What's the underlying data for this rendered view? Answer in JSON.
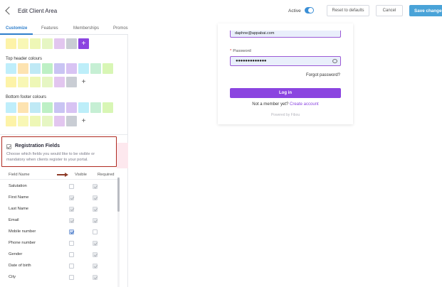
{
  "header": {
    "title": "Edit Client Area",
    "active_label": "Active",
    "reset_label": "Reset to defaults",
    "cancel_label": "Cancel",
    "save_label": "Save changes"
  },
  "tabs": [
    {
      "label": "Customize",
      "active": true
    },
    {
      "label": "Features",
      "active": false
    },
    {
      "label": "Memberships",
      "active": false
    },
    {
      "label": "Promos",
      "active": false
    }
  ],
  "colors": {
    "accent": "#2e7ecb",
    "brand_purple": "#8b45e0",
    "save_button": "#49a3d8",
    "highlight_border": "#b02a21"
  },
  "palette_top": [
    "#fdf3a8",
    "#f8f7b5",
    "#eef7b6",
    "#e6f6c3",
    "#e2c6ef",
    "#c9cdd4"
  ],
  "palette_rows": [
    [
      "#bfeefb",
      "#fde3b0",
      "#bfe9f5",
      "#bdf0c5",
      "#c9c4f3",
      "#d8c3f3",
      "#bdeef9",
      "#c6efd4",
      "#d8f6b5"
    ],
    [
      "#fdf3a8",
      "#f8f7b5",
      "#eef7b6",
      "#e6f6c3",
      "#e2c6ef",
      "#c9cdd4"
    ]
  ],
  "sections": {
    "top_header": "Top header colours",
    "bottom_footer": "Bottom footer colours"
  },
  "registration": {
    "title": "Registration Fields",
    "description": "Choose which fields you would like to be visible or mandatory when clients register to your portal.",
    "col_field": "Field Name",
    "col_visible": "Visible",
    "col_required": "Required",
    "fields": [
      {
        "name": "Salutation",
        "visible": "off",
        "required": "disabled"
      },
      {
        "name": "First Name",
        "visible": "locked",
        "required": "locked"
      },
      {
        "name": "Last Name",
        "visible": "locked",
        "required": "locked"
      },
      {
        "name": "Email",
        "visible": "locked",
        "required": "locked"
      },
      {
        "name": "Mobile number",
        "visible": "on",
        "required": "off"
      },
      {
        "name": "Phone number",
        "visible": "off",
        "required": "disabled"
      },
      {
        "name": "Gender",
        "visible": "off",
        "required": "disabled"
      },
      {
        "name": "Date of birth",
        "visible": "off",
        "required": "disabled"
      },
      {
        "name": "City",
        "visible": "off",
        "required": "disabled"
      }
    ]
  },
  "preview": {
    "email_value": "daphne@appabai.com",
    "password_label": "Password",
    "password_dots": "●●●●●●●●●●●●●",
    "forgot": "Forgot password?",
    "login": "Log in",
    "not_member": "Not a member yet?",
    "create_account": "Create account",
    "powered": "Powered by Fibou"
  }
}
